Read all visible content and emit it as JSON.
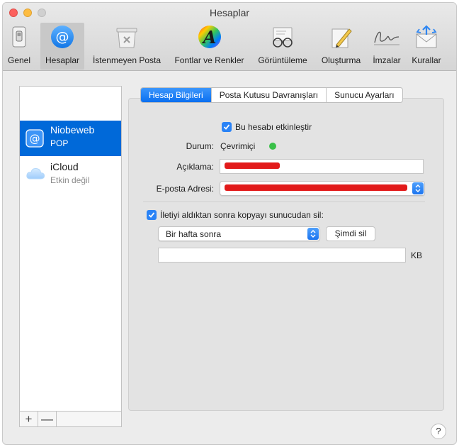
{
  "window": {
    "title": "Hesaplar"
  },
  "toolbar": {
    "items": [
      {
        "label": "Genel",
        "icon": "general-switch-icon"
      },
      {
        "label": "Hesaplar",
        "icon": "accounts-at-icon"
      },
      {
        "label": "İstenmeyen Posta",
        "icon": "junk-mail-icon"
      },
      {
        "label": "Fontlar ve Renkler",
        "icon": "fonts-colors-icon"
      },
      {
        "label": "Görüntüleme",
        "icon": "viewing-glasses-icon"
      },
      {
        "label": "Oluşturma",
        "icon": "composing-pen-icon"
      },
      {
        "label": "İmzalar",
        "icon": "signature-icon"
      },
      {
        "label": "Kurallar",
        "icon": "rules-envelope-icon"
      }
    ]
  },
  "accounts": [
    {
      "name": "Niobeweb",
      "type": "POP",
      "selected": true
    },
    {
      "name": "iCloud",
      "type": "Etkin değil",
      "selected": false
    }
  ],
  "list_footer": {
    "add": "+",
    "remove": "—"
  },
  "tabs": [
    {
      "label": "Hesap Bilgileri",
      "active": true
    },
    {
      "label": "Posta Kutusu Davranışları",
      "active": false
    },
    {
      "label": "Sunucu Ayarları",
      "active": false
    }
  ],
  "form": {
    "enable_account_label": "Bu hesabı etkinleştir",
    "status_label": "Durum:",
    "status_value": "Çevrimiçi",
    "description_label": "Açıklama:",
    "email_label": "E-posta Adresi:",
    "delete_label": "İletiyi aldıktan sonra kopyayı sunucudan sil:",
    "delete_period": "Bir hafta sonra",
    "delete_now_button": "Şimdi sil",
    "size_unit": "KB"
  },
  "help": "?",
  "colors": {
    "accent": "#0069d9",
    "status_online": "#39c048",
    "redaction": "#e21a1a"
  }
}
